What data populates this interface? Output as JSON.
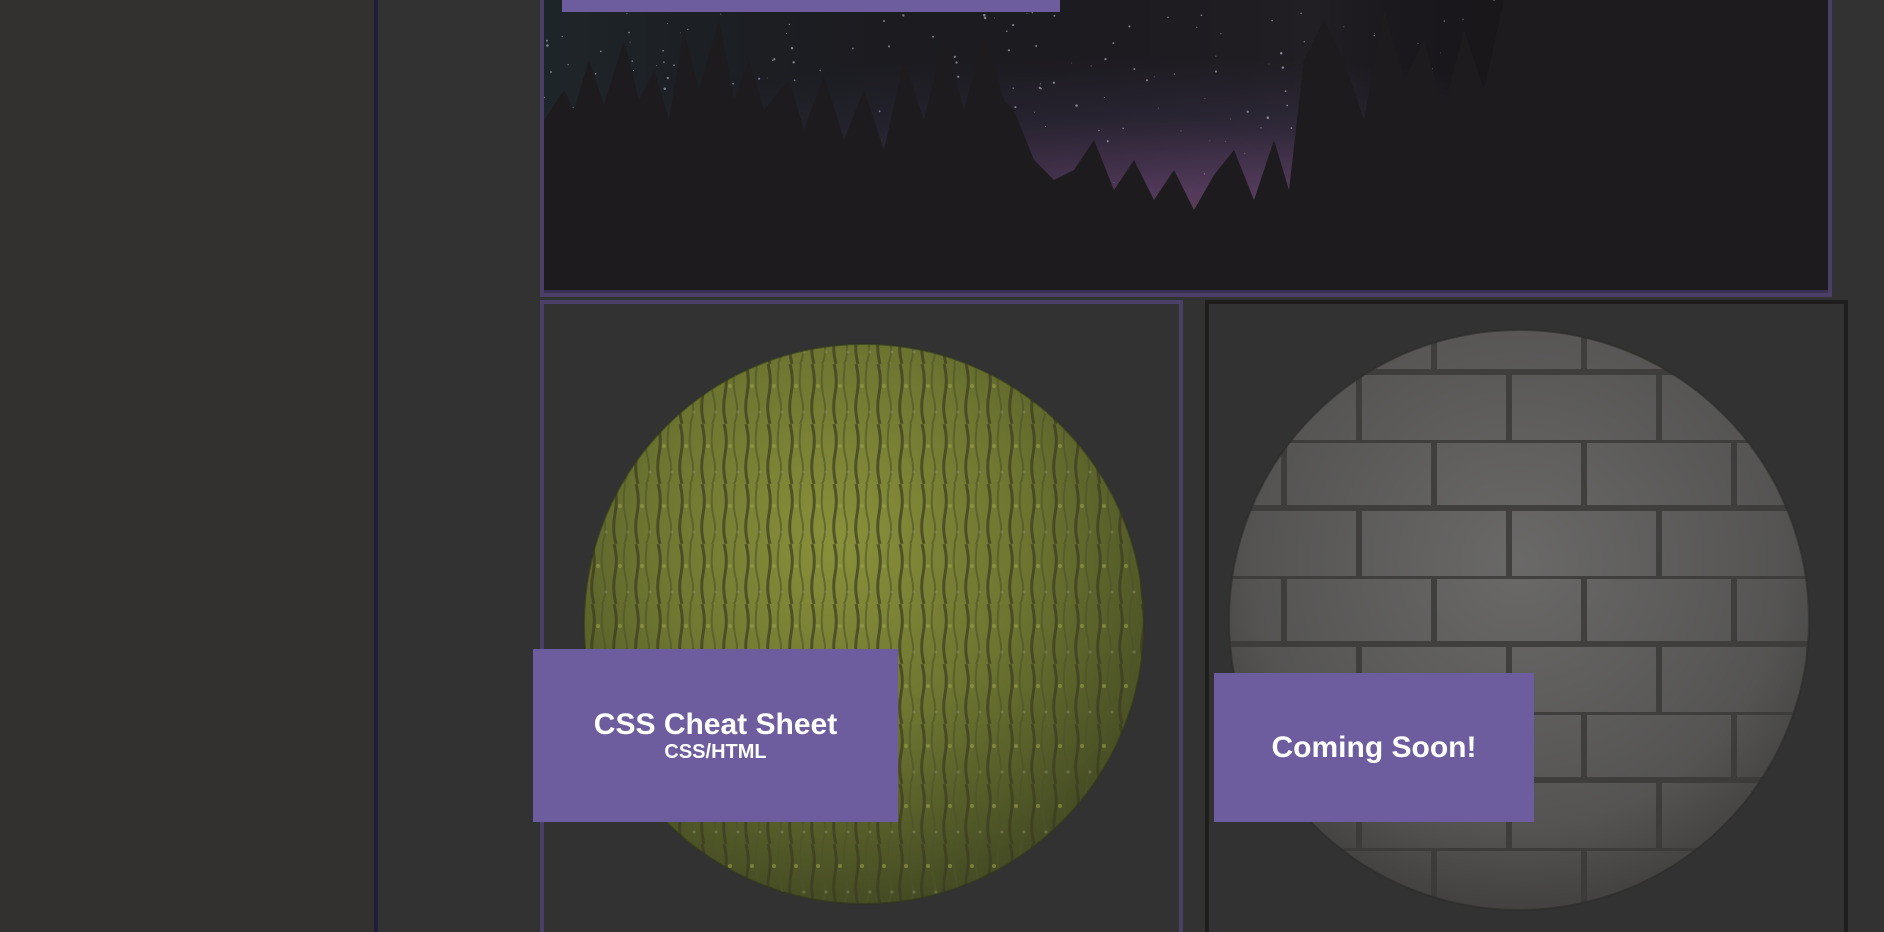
{
  "cards": [
    {
      "title": "CSS Cheat Sheet",
      "subtitle": "CSS/HTML",
      "image": "moss-bark-sphere"
    },
    {
      "title": "Coming Soon!",
      "subtitle": "",
      "image": "stone-brick-sphere"
    }
  ],
  "hero": {
    "image": "night-sky-forest"
  },
  "colors": {
    "accent": "#6e5d9e",
    "hero_border": "#4a3f66",
    "background": "#333232",
    "sidebar_divider": "#1e1d3a"
  }
}
